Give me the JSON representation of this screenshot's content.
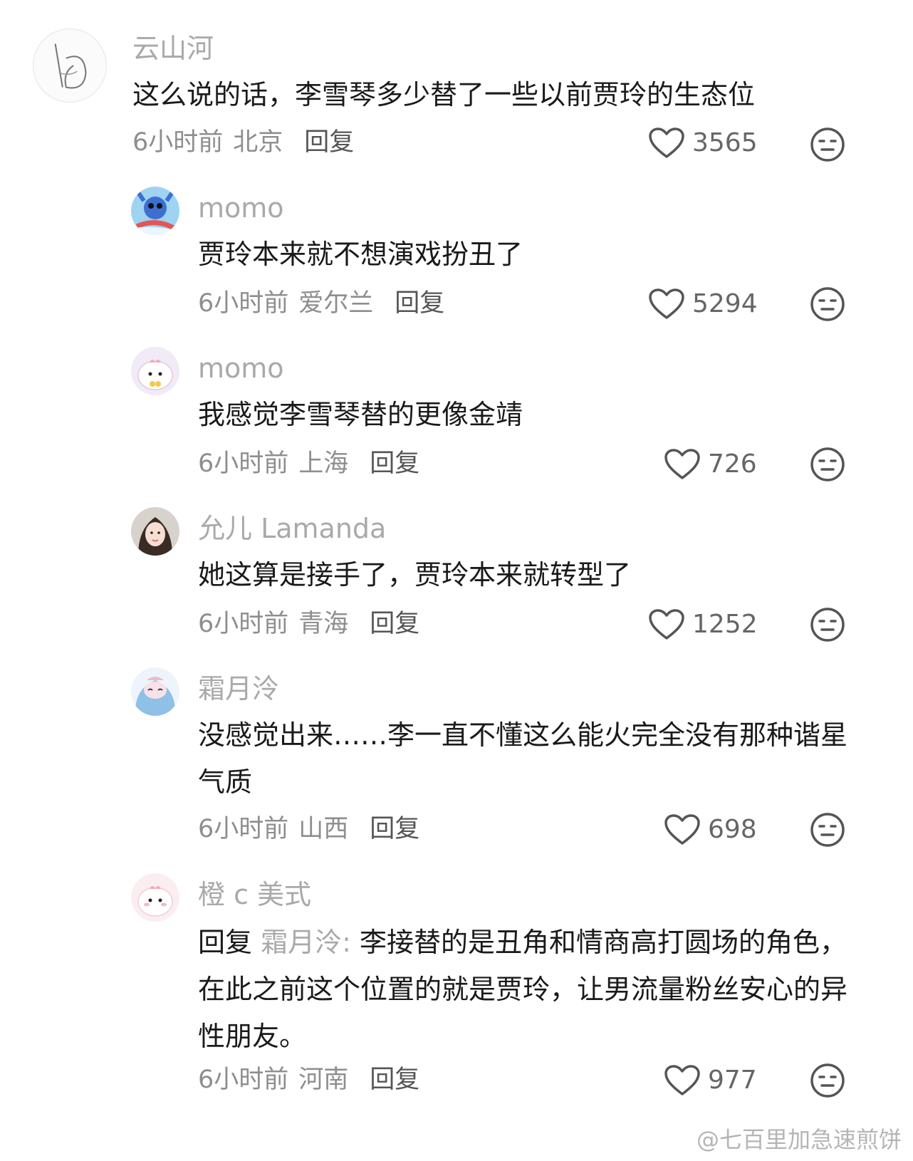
{
  "comments": [
    {
      "name": "云山河",
      "text": "这么说的话，李雪琴多少替了一些以前贾玲的生态位",
      "time": "6小时前",
      "location": "北京",
      "reply_label": "回复",
      "likes": "3565"
    },
    {
      "name": "momo",
      "text": "贾玲本来就不想演戏扮丑了",
      "time": "6小时前",
      "location": "爱尔兰",
      "reply_label": "回复",
      "likes": "5294"
    },
    {
      "name": "momo",
      "text": "我感觉李雪琴替的更像金靖",
      "time": "6小时前",
      "location": "上海",
      "reply_label": "回复",
      "likes": "726"
    },
    {
      "name": "允儿 Lamanda",
      "text": "她这算是接手了，贾玲本来就转型了",
      "time": "6小时前",
      "location": "青海",
      "reply_label": "回复",
      "likes": "1252"
    },
    {
      "name": "霜月泠",
      "text": "没感觉出来……李一直不懂这么能火完全没有那种谐星气质",
      "time": "6小时前",
      "location": "山西",
      "reply_label": "回复",
      "likes": "698"
    },
    {
      "name": "橙 c 美式",
      "reply_prefix": "回复",
      "reply_target": "霜月泠:",
      "text": "李接替的是丑角和情商高打圆场的角色，在此之前这个位置的就是贾玲，让男流量粉丝安心的异性朋友。",
      "time": "6小时前",
      "location": "河南",
      "reply_label": "回复",
      "likes": "977"
    }
  ],
  "watermark": "@七百里加急速煎饼",
  "icons": {
    "like": "heart-outline-icon",
    "reaction": "neutral-face-icon"
  },
  "colors": {
    "name": "#a9a9a9",
    "text": "#1a1a1a",
    "meta": "#8e8e8e",
    "icon": "#555555"
  }
}
